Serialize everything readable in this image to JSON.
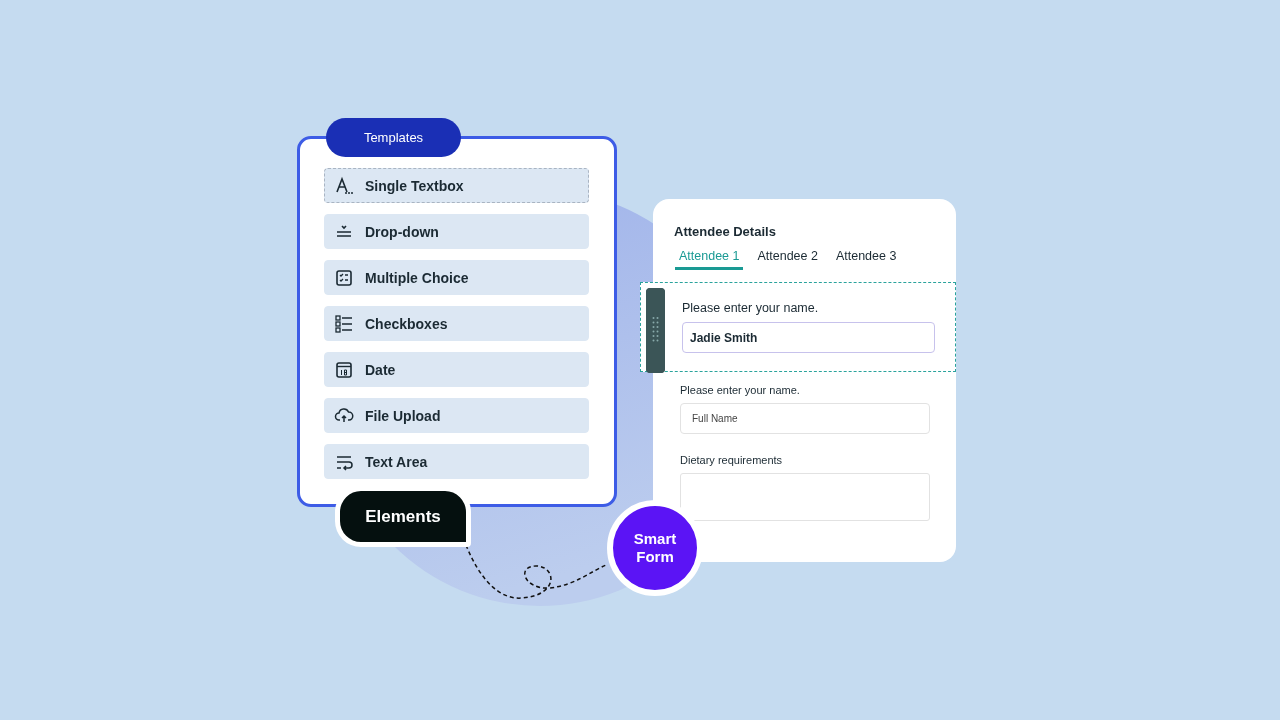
{
  "templates_panel": {
    "title": "Templates",
    "items": [
      {
        "label": "Single Textbox",
        "selected": true
      },
      {
        "label": "Drop-down",
        "selected": false
      },
      {
        "label": "Multiple Choice",
        "selected": false
      },
      {
        "label": "Checkboxes",
        "selected": false
      },
      {
        "label": "Date",
        "selected": false
      },
      {
        "label": "File Upload",
        "selected": false
      },
      {
        "label": "Text Area",
        "selected": false
      }
    ],
    "badge": "Elements"
  },
  "form_card": {
    "title": "Attendee Details",
    "tabs": [
      {
        "label": "Attendee 1",
        "selected": true
      },
      {
        "label": "Attendee 2",
        "selected": false
      },
      {
        "label": "Attendee 3",
        "selected": false
      }
    ],
    "fields": [
      {
        "kind": "input",
        "label": "Please enter your name.",
        "value": "Jadie Smith",
        "selected": true
      },
      {
        "kind": "input",
        "label": "Please enter your name.",
        "placeholder": "Full Name",
        "selected": false
      },
      {
        "kind": "textarea",
        "label": "Dietary requirements",
        "selected": false
      }
    ]
  },
  "smart_badge": {
    "label": "Smart Form"
  }
}
